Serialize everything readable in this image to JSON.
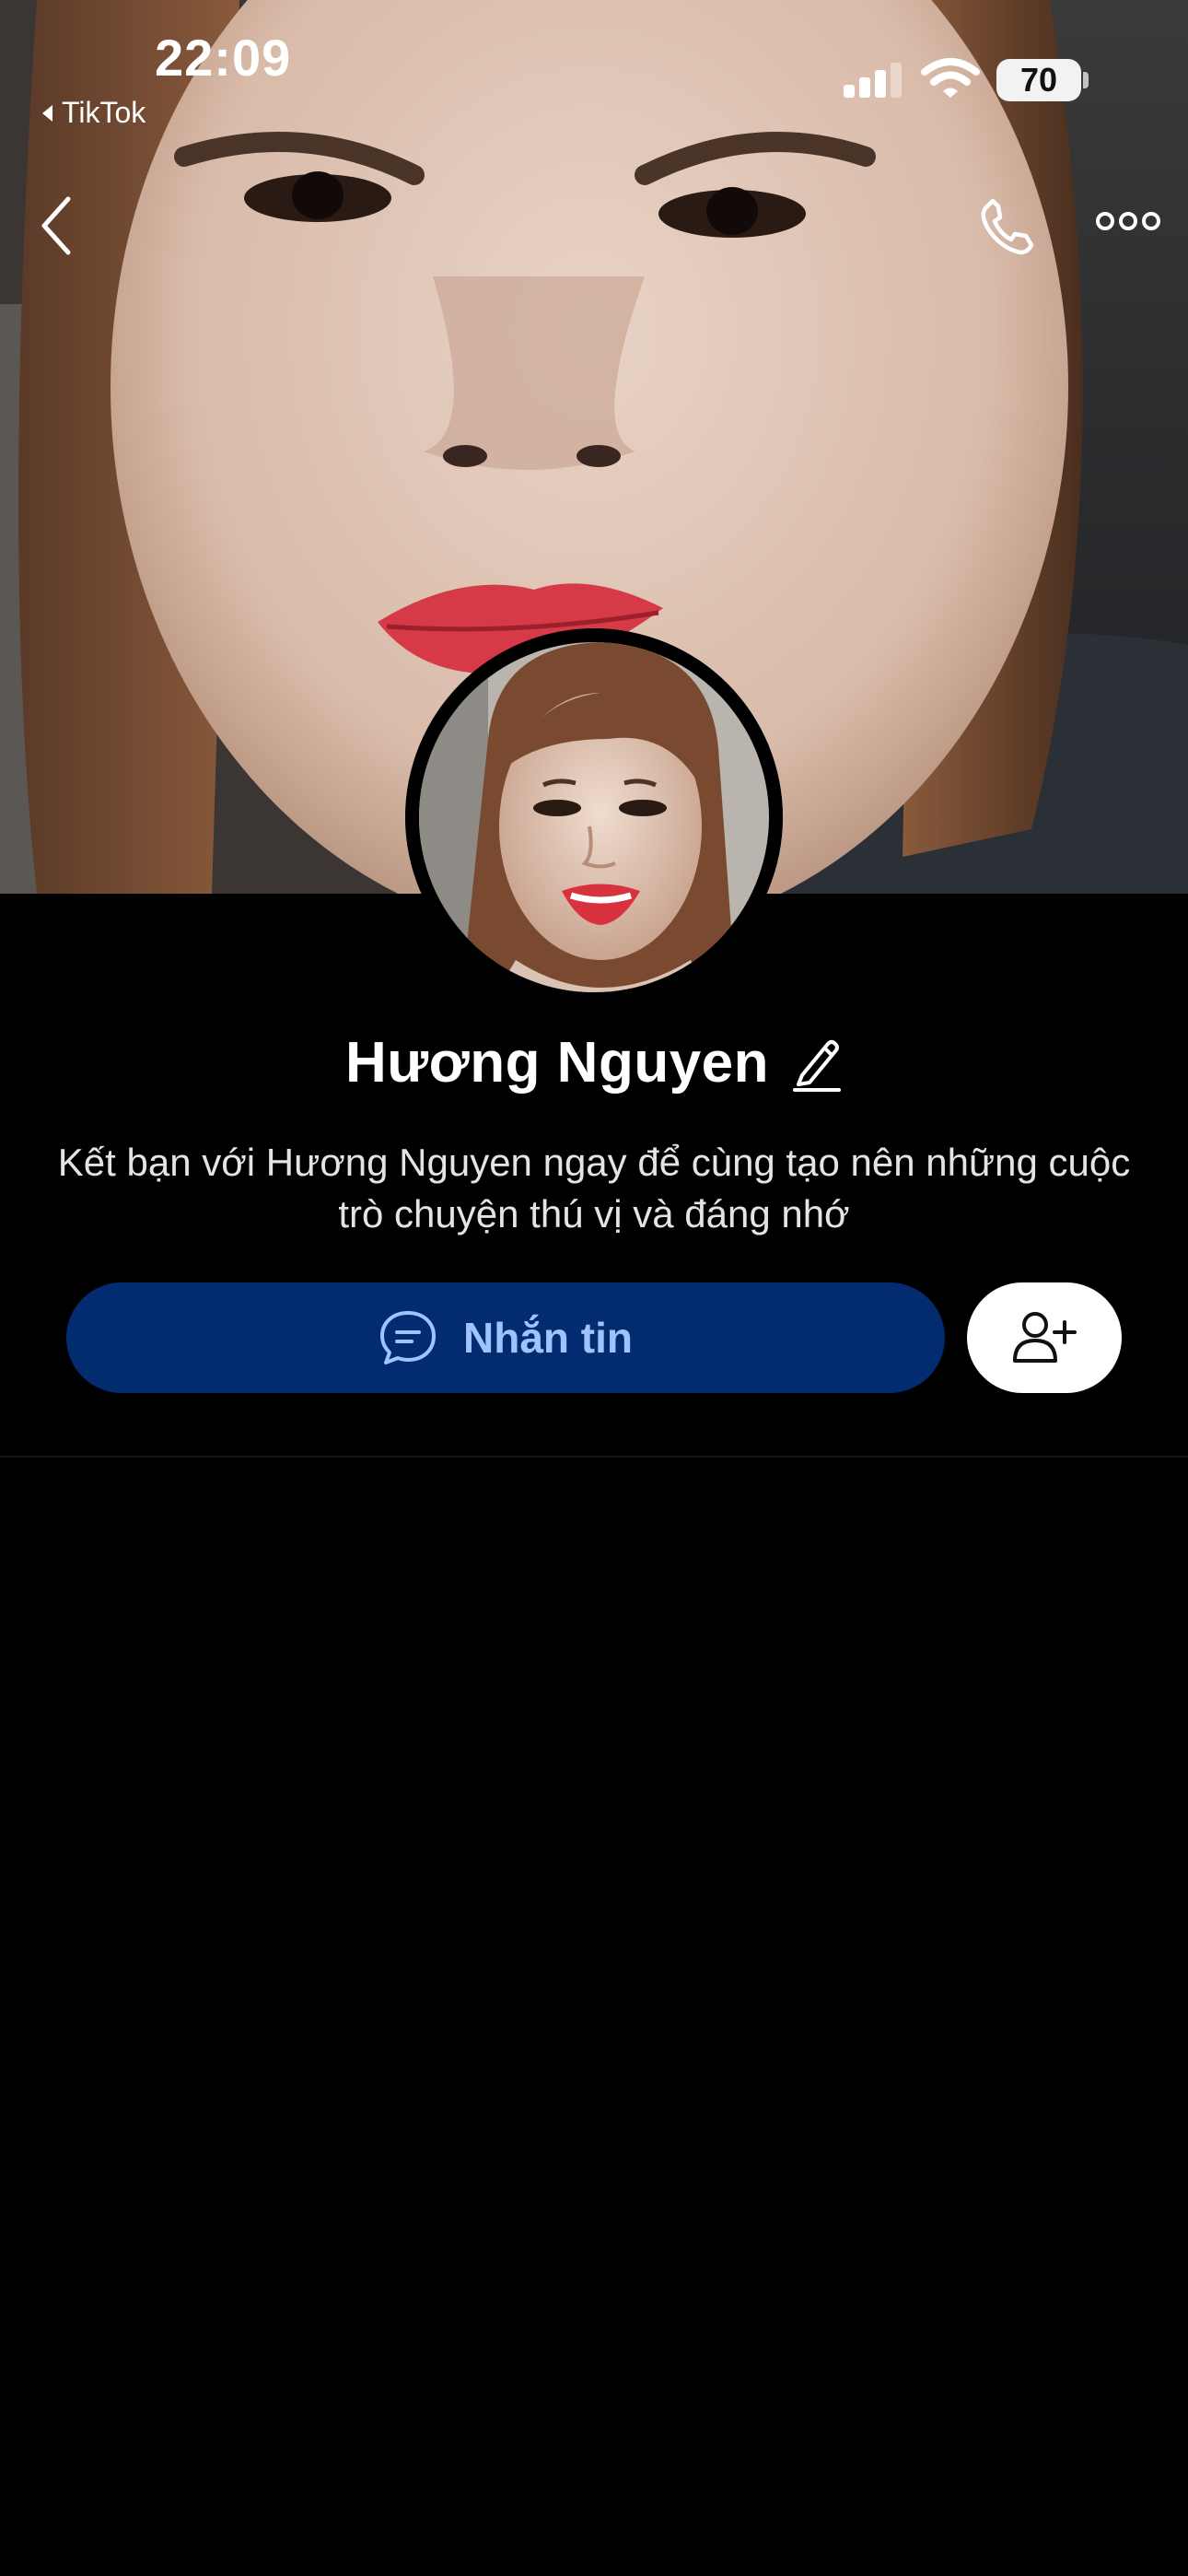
{
  "status_bar": {
    "time": "22:09",
    "back_app": "TikTok",
    "battery": "70",
    "icons": [
      "cellular-signal-icon",
      "wifi-icon",
      "battery-icon"
    ]
  },
  "nav": {
    "icons": [
      "back-chevron-icon",
      "phone-icon",
      "more-icon"
    ]
  },
  "profile": {
    "name": "Hương Nguyen",
    "description": "Kết bạn với Hương Nguyen ngay để cùng tạo nên những cuộc trò chuyện thú vị và đáng nhớ",
    "edit_icon": "pencil-icon"
  },
  "actions": {
    "message_label": "Nhắn tin",
    "message_icon": "chat-bubble-icon",
    "add_friend_icon": "add-user-icon"
  },
  "colors": {
    "background": "#000000",
    "message_button": "#022c6f",
    "message_text": "#9fc3ff",
    "add_friend_button": "#ffffff"
  }
}
